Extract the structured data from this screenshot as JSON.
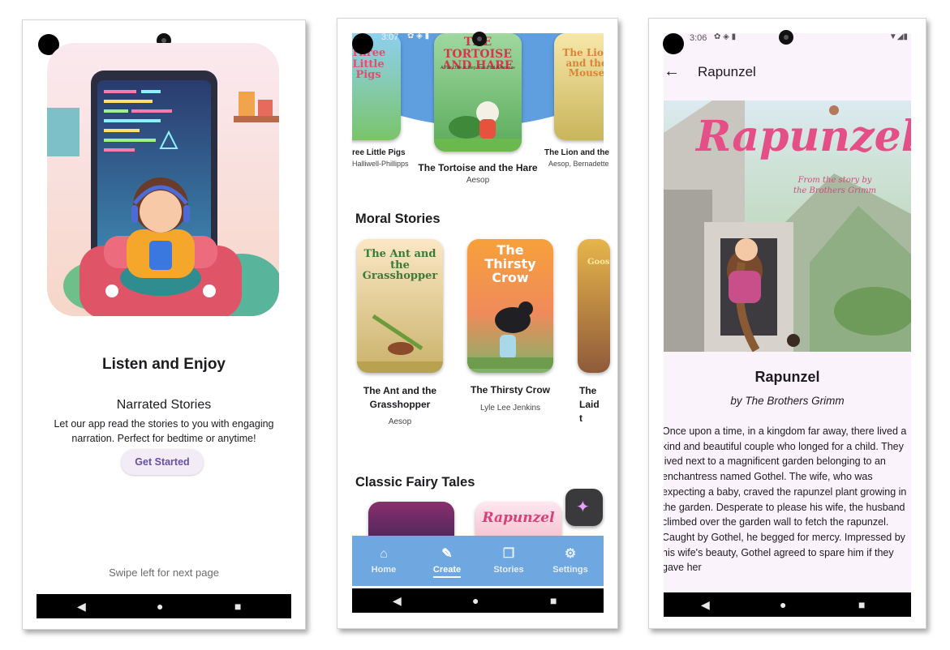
{
  "screen1": {
    "heading": "Listen and Enjoy",
    "subheading": "Narrated Stories",
    "description": "Let our app read the stories to you with engaging narration. Perfect for bedtime or anytime!",
    "cta_label": "Get Started",
    "swipe_hint": "Swipe left for next page"
  },
  "screen2": {
    "status_time": "3:07",
    "featured": [
      {
        "cover": "Three Little Pigs",
        "title": "ree Little Pigs",
        "author": "Halliwell-Phillipps"
      },
      {
        "cover": "THE TORTOISE AND HARE",
        "cover_sub": "A Fairy Tale or Step-Your-Paid-Reference",
        "title": "The Tortoise and the Hare",
        "author": "Aesop"
      },
      {
        "cover": "The Lion and the Mouse",
        "title": "The Lion and the",
        "author": "Aesop, Bernadette"
      }
    ],
    "moral_heading": "Moral Stories",
    "moral": [
      {
        "cover": "The Ant and the Grasshopper",
        "title": "The Ant and the Grasshopper",
        "author": "Aesop"
      },
      {
        "cover": "The Thirsty Crow",
        "title": "The Thirsty Crow",
        "author": "Lyle Lee Jenkins"
      },
      {
        "cover": "Goose",
        "title": "The Laid t",
        "author": ""
      }
    ],
    "fairy_heading": "Classic Fairy Tales",
    "fairy_cover_2": "Rapunzel",
    "tabs": [
      {
        "label": "Home",
        "icon": "home-icon"
      },
      {
        "label": "Create",
        "icon": "pencil-icon"
      },
      {
        "label": "Stories",
        "icon": "library-icon"
      },
      {
        "label": "Settings",
        "icon": "gear-icon"
      }
    ],
    "active_tab": "Create"
  },
  "screen3": {
    "status_time": "3:06",
    "app_bar_title": "Rapunzel",
    "hero_title": "Rapunzel",
    "hero_subtitle": "From the story by the Brothers Grimm",
    "story_title": "Rapunzel",
    "story_author": "by The Brothers Grimm",
    "story_text": "Once upon a time, in a kingdom far away, there lived a kind and beautiful couple who longed for a child. They lived next to a magnificent garden belonging to an enchantress named Gothel. The wife, who was expecting a baby, craved the rapunzel plant growing in the garden. Desperate to please his wife, the husband climbed over the garden wall to fetch the rapunzel. Caught by Gothel, he begged for mercy. Impressed by his wife's beauty, Gothel agreed to spare him if they gave her"
  },
  "system_nav": {
    "back": "◀",
    "home": "●",
    "recents": "■"
  },
  "colors": {
    "accent": "#6750a4",
    "tab_bar": "#6fa7e0",
    "screen3_bg": "#fbf3fb",
    "cta_bg": "#f1ecf6"
  }
}
